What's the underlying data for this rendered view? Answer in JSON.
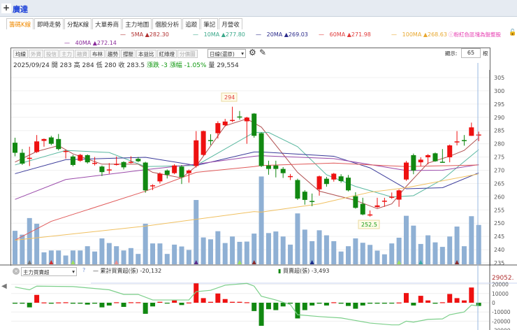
{
  "header": {
    "title": "廣達",
    "plus": "+"
  },
  "tabs": [
    "籌碼K線",
    "即時走勢",
    "分點K線",
    "大單券商",
    "主力地圖",
    "個股分析",
    "追蹤",
    "筆記",
    "月營收"
  ],
  "ma_legend": [
    {
      "label": "5MA ▲282.30",
      "color": "#b03030"
    },
    {
      "label": "10MA ▲277.80",
      "color": "#3aa88a"
    },
    {
      "label": "20MA ▲269.03",
      "color": "#2a2a8a"
    },
    {
      "label": "60MA ▲271.98",
      "color": "#e03a3a"
    },
    {
      "label": "100MA ▲268.63",
      "color": "#e8a830"
    },
    {
      "label": "40MA ▲272.14",
      "color": "#8a2a9a"
    }
  ],
  "note": "ⓘ粉紅色區塊為盤整股",
  "toolbar": {
    "buttons": [
      {
        "l": "均線",
        "d": false
      },
      {
        "l": "外資",
        "d": true
      },
      {
        "l": "投信",
        "d": true
      },
      {
        "l": "主力",
        "d": true
      },
      {
        "l": "融資",
        "d": true
      },
      {
        "l": "布林",
        "d": false
      },
      {
        "l": "趨勢",
        "d": false
      },
      {
        "l": "撐壓",
        "d": false
      },
      {
        "l": "本益比",
        "d": false
      },
      {
        "l": "紅綠燈",
        "d": false
      },
      {
        "l": "分價圖",
        "d": true
      }
    ],
    "period": "日線(還原)",
    "display_label": "顯示:",
    "display_count": "65",
    "unit": "根"
  },
  "info": {
    "date": "2025/09/24",
    "open": "開 283",
    "high": "高 284",
    "low": "低 280",
    "close": "收 283.5",
    "change": "漲跌 -3",
    "pct": "漲幅 -1.05%",
    "volume": "量 29,554"
  },
  "colors": {
    "up": "#ee1111",
    "down": "#118811",
    "volume": "#8fb0d4"
  },
  "chart_data": {
    "type": "candlestick",
    "ylim": [
      235,
      307
    ],
    "yticks": [
      235,
      240,
      245,
      250,
      255,
      260,
      265,
      270,
      275,
      280,
      285,
      290,
      295,
      300,
      305
    ],
    "max_label": "294",
    "min_label": "252.5",
    "ohlc": [
      [
        280.4,
        282.3,
        275.3,
        276.6
      ],
      [
        276.6,
        278,
        272,
        272.5
      ],
      [
        274.5,
        278.9,
        271.6,
        274.7
      ],
      [
        276.9,
        283.3,
        276.5,
        280.9
      ],
      [
        281.1,
        282,
        278.9,
        281.8
      ],
      [
        282.4,
        283,
        279.5,
        280
      ],
      [
        281.8,
        283.7,
        277.5,
        278
      ],
      [
        277.1,
        277.8,
        274.4,
        277.3
      ],
      [
        275.2,
        275.8,
        271.5,
        272
      ],
      [
        273.6,
        276.2,
        273.2,
        275.8
      ],
      [
        275.7,
        276,
        272.5,
        273
      ],
      [
        272.6,
        275,
        271.8,
        272.8
      ],
      [
        271.4,
        271.8,
        267.8,
        269.3
      ],
      [
        270.1,
        272.7,
        268.7,
        270.3
      ],
      [
        272.2,
        275.2,
        271.8,
        272.4
      ],
      [
        273.1,
        273.4,
        270.3,
        271.1
      ],
      [
        273,
        275.3,
        272.6,
        273.2
      ],
      [
        274.3,
        275,
        273,
        273.4
      ],
      [
        272.9,
        273.2,
        261.5,
        262.4
      ],
      [
        264.1,
        264.7,
        262.5,
        264.3
      ],
      [
        265.8,
        269.2,
        265,
        268.7
      ],
      [
        269.9,
        270.3,
        266.9,
        268.3
      ],
      [
        268.9,
        272.3,
        268.5,
        271.8
      ],
      [
        271.4,
        272,
        264.8,
        267.4
      ],
      [
        268.9,
        270.3,
        265.3,
        269.9
      ],
      [
        271.6,
        284.8,
        271,
        281.3
      ],
      [
        275.8,
        285,
        275.5,
        284.8
      ],
      [
        281.4,
        283.6,
        279.5,
        281.3
      ],
      [
        284,
        288.5,
        282,
        287.8
      ],
      [
        287,
        289.4,
        286.5,
        288.4
      ],
      [
        288.8,
        294,
        288.2,
        289
      ],
      [
        290.3,
        292.4,
        289.1,
        290.2
      ],
      [
        288.5,
        290.2,
        280,
        289.9
      ],
      [
        291.4,
        291.6,
        282.3,
        283
      ],
      [
        284,
        284.3,
        271.2,
        271.6
      ],
      [
        271.8,
        273.6,
        268.3,
        270.5
      ],
      [
        271.8,
        273.6,
        267.3,
        270.5
      ],
      [
        270.5,
        271.2,
        267.1,
        268.9
      ],
      [
        267.6,
        268.6,
        266.3,
        267.8
      ],
      [
        266.3,
        266.8,
        258.8,
        259.3
      ],
      [
        261.9,
        262.5,
        257,
        258.8
      ],
      [
        258.4,
        261.2,
        256.4,
        258.2
      ],
      [
        262.8,
        268,
        260.4,
        267.7
      ],
      [
        266.8,
        267.5,
        263.8,
        264.8
      ],
      [
        266.5,
        269,
        265.7,
        268.7
      ],
      [
        267.7,
        268.5,
        265.3,
        265.9
      ],
      [
        267.2,
        268.2,
        262,
        262.4
      ],
      [
        260.2,
        261.7,
        255.5,
        255.8
      ],
      [
        257.3,
        259.6,
        253,
        253.3
      ],
      [
        253.1,
        254.8,
        252.5,
        253.3
      ],
      [
        256.1,
        259.6,
        255.8,
        256.7
      ],
      [
        258.3,
        259.6,
        256.2,
        258.5
      ],
      [
        259.8,
        261.6,
        259.2,
        260
      ],
      [
        258.9,
        262.8,
        256.2,
        262.4
      ],
      [
        266.5,
        273.5,
        266,
        272.9
      ],
      [
        275.7,
        276.3,
        268.5,
        269.9
      ],
      [
        273,
        274.9,
        271.6,
        274
      ],
      [
        274.9,
        276.1,
        272.2,
        275.7
      ],
      [
        276.4,
        276.7,
        273.2,
        273.4
      ],
      [
        273.2,
        278,
        272.9,
        273.1
      ],
      [
        274.9,
        279.7,
        273,
        279.4
      ],
      [
        280.7,
        284.8,
        279.4,
        280.9
      ],
      [
        281.4,
        283.3,
        279.3,
        281.2
      ],
      [
        283,
        288,
        283,
        286.2
      ],
      [
        283.2,
        284.6,
        281,
        283.5
      ]
    ],
    "volume_k": [
      25.2,
      22.3,
      34.8,
      30.5,
      9.0,
      10.4,
      10.4,
      6.6,
      10.4,
      10.4,
      13.6,
      9.6,
      19.5,
      16.0,
      13.6,
      10.4,
      12.2,
      7.8,
      30.5,
      15.7,
      15.7,
      7.8,
      14.8,
      13.4,
      10.8,
      48.4,
      20.2,
      18.8,
      24.9,
      16.0,
      20.9,
      16.9,
      17.1,
      23.1,
      66.1,
      23.5,
      24.7,
      20.9,
      14.8,
      38.3,
      26.1,
      17.4,
      25.6,
      21.8,
      17.4,
      9.6,
      13.6,
      19.5,
      16.2,
      14.6,
      10.3,
      7.5,
      15.7,
      20.0,
      36.5,
      29.1,
      15.3,
      21.8,
      16.5,
      13.1,
      20.9,
      28.4,
      13.6,
      36.2,
      29.6
    ],
    "ma_points": {
      "ma5": [
        [
          0,
          273.1
        ],
        [
          3,
          277.1
        ],
        [
          6,
          279.3
        ],
        [
          8,
          276.2
        ],
        [
          12,
          272.3
        ],
        [
          17,
          272.3
        ],
        [
          19,
          269.2
        ],
        [
          23,
          267.1
        ],
        [
          25,
          271.5
        ],
        [
          29,
          286.8
        ],
        [
          32,
          289.4
        ],
        [
          34,
          286.3
        ],
        [
          39,
          269.2
        ],
        [
          42,
          262.1
        ],
        [
          47,
          258.6
        ],
        [
          50,
          255.5
        ],
        [
          52,
          257.3
        ],
        [
          54,
          263.9
        ],
        [
          57,
          272.7
        ],
        [
          60,
          275.3
        ],
        [
          62,
          277.5
        ],
        [
          64,
          282.3
        ]
      ],
      "ma10": [
        [
          0,
          272
        ],
        [
          7,
          277.5
        ],
        [
          13,
          276.7
        ],
        [
          18,
          271.4
        ],
        [
          25,
          271.8
        ],
        [
          33,
          284.3
        ],
        [
          35,
          284.3
        ],
        [
          39,
          278.9
        ],
        [
          43,
          268.3
        ],
        [
          47,
          263.9
        ],
        [
          52,
          259.9
        ],
        [
          55,
          260.4
        ],
        [
          59,
          266.5
        ],
        [
          64,
          277.8
        ]
      ],
      "ma20": [
        [
          0,
          268.7
        ],
        [
          7,
          274
        ],
        [
          18,
          274.9
        ],
        [
          25,
          271.8
        ],
        [
          33,
          276.9
        ],
        [
          34,
          276.9
        ],
        [
          44,
          275.3
        ],
        [
          49,
          270.9
        ],
        [
          54,
          263
        ],
        [
          59,
          263.4
        ],
        [
          64,
          269.03
        ]
      ],
      "ma40": [
        [
          0,
          259
        ],
        [
          7,
          266.5
        ],
        [
          18,
          270.2
        ],
        [
          25,
          272.3
        ],
        [
          33,
          275.3
        ],
        [
          34,
          275.5
        ],
        [
          44,
          274.4
        ],
        [
          54,
          269.9
        ],
        [
          59,
          270
        ],
        [
          64,
          272.14
        ]
      ],
      "ma60": [
        [
          0,
          243.6
        ],
        [
          5,
          250.7
        ],
        [
          9,
          254.2
        ],
        [
          18,
          262.1
        ],
        [
          25,
          269.2
        ],
        [
          33,
          271.4
        ],
        [
          34,
          271.8
        ],
        [
          44,
          272.7
        ],
        [
          54,
          271.4
        ],
        [
          64,
          271.98
        ]
      ],
      "ma100": [
        [
          0,
          243.6
        ],
        [
          18,
          248.9
        ],
        [
          33,
          254.4
        ],
        [
          34,
          254.2
        ],
        [
          42,
          257.3
        ],
        [
          49,
          261.7
        ],
        [
          54,
          263.4
        ],
        [
          64,
          268.63
        ]
      ]
    },
    "sub": {
      "selector": "主力買賣超",
      "help": "?",
      "cum_label": "累計買賣超(張) -20,132",
      "bar_label": "買賣超(張) -3,493",
      "top_label": "29052.",
      "yticks": [
        20000,
        10000,
        0,
        -10000,
        -20000,
        -30000
      ],
      "bars_k": [
        -1,
        -1,
        -5,
        8.5,
        0.3,
        -1,
        0.3,
        0.5,
        -1,
        -1,
        -2,
        -1,
        -5,
        -3,
        0.5,
        -4.5,
        0.5,
        0.5,
        -12,
        -4,
        1,
        -0.5,
        2.5,
        -2.5,
        0.2,
        21,
        5,
        1,
        10,
        4,
        1,
        1,
        0.5,
        -9,
        -25,
        -7,
        -8,
        -4,
        -1,
        -17,
        -8,
        -3,
        -1,
        -3,
        0.5,
        -1,
        -3.5,
        -6.5,
        -3,
        -1,
        -1,
        -1,
        -0.5,
        0.2,
        10.5,
        -3,
        7.5,
        2.5,
        -1,
        0.5,
        9.5,
        5,
        2.5,
        16.5,
        -3.5
      ],
      "cum_points_k": [
        [
          0,
          17
        ],
        [
          2,
          14
        ],
        [
          3,
          18
        ],
        [
          8,
          17.5
        ],
        [
          13,
          14
        ],
        [
          15,
          9
        ],
        [
          17,
          9
        ],
        [
          19,
          3
        ],
        [
          24,
          3
        ],
        [
          25,
          12
        ],
        [
          27,
          13.5
        ],
        [
          29,
          19
        ],
        [
          32,
          21
        ],
        [
          33,
          18
        ],
        [
          34,
          7
        ],
        [
          36,
          3
        ],
        [
          38,
          -2
        ],
        [
          39,
          -13
        ],
        [
          42,
          -15
        ],
        [
          45,
          -16.5
        ],
        [
          49,
          -22
        ],
        [
          52,
          -24
        ],
        [
          53,
          -24
        ],
        [
          54,
          -20
        ],
        [
          55,
          -21
        ],
        [
          57,
          -18
        ],
        [
          59,
          -17.5
        ],
        [
          60,
          -13
        ],
        [
          62,
          -10
        ],
        [
          63,
          -2.5
        ],
        [
          64,
          -3.5
        ]
      ]
    }
  }
}
